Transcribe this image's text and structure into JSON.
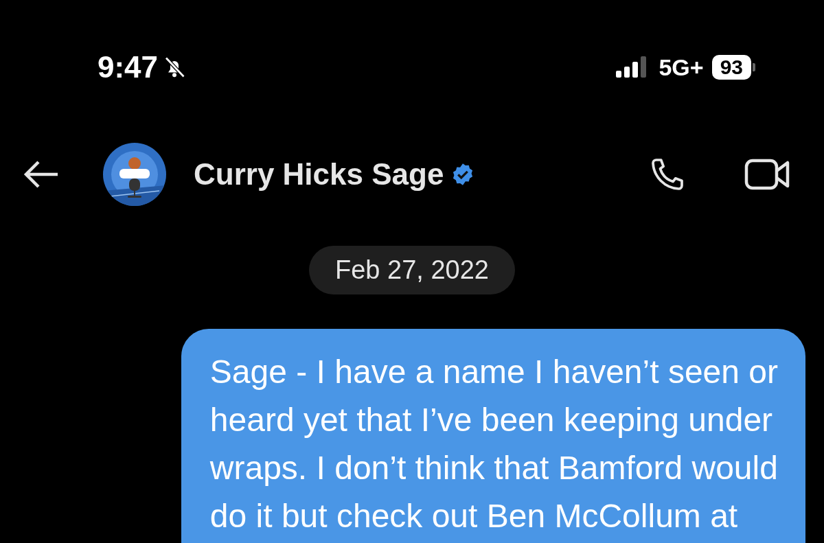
{
  "status_bar": {
    "time": "9:47",
    "silent": true,
    "network": "5G+",
    "battery": "93"
  },
  "header": {
    "name": "Curry Hicks Sage",
    "verified": true
  },
  "date_separator": "Feb 27, 2022",
  "messages": [
    {
      "kind": "sent",
      "lines": [
        "Sage - I have a name I haven’t seen or",
        "heard yet that I’ve been keeping under",
        "wraps. I don’t think that Bamford would",
        "do it but check out Ben McCollum at"
      ]
    }
  ]
}
